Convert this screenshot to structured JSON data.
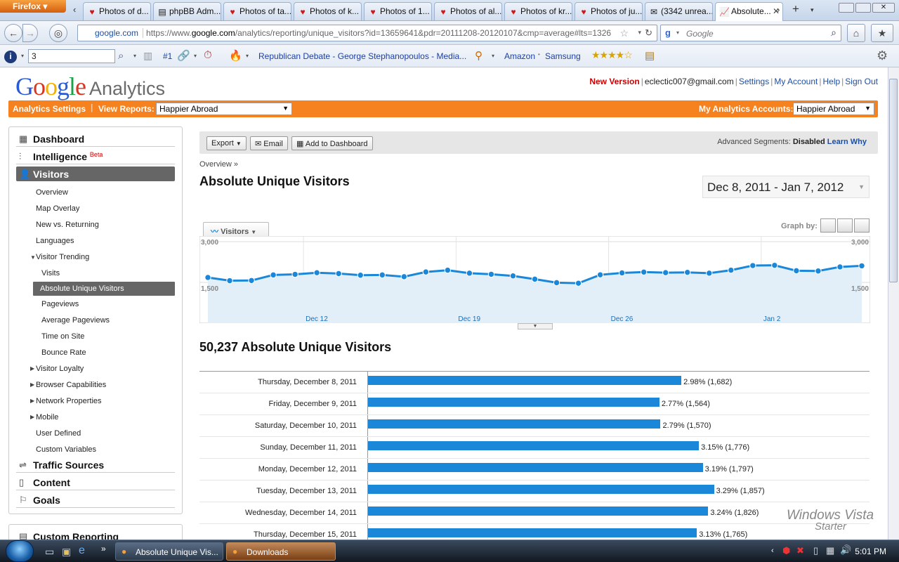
{
  "browser": {
    "firefox_label": "Firefox",
    "tabs": [
      {
        "title": "Photos of d...",
        "icon": "heart-icon"
      },
      {
        "title": "phpBB Adm...",
        "icon": "forum-icon"
      },
      {
        "title": "Photos of ta...",
        "icon": "heart-icon"
      },
      {
        "title": "Photos of k...",
        "icon": "heart-icon"
      },
      {
        "title": "Photos of 1...",
        "icon": "heart-icon"
      },
      {
        "title": "Photos of al...",
        "icon": "heart-icon"
      },
      {
        "title": "Photos of kr...",
        "icon": "heart-icon"
      },
      {
        "title": "Photos of ju...",
        "icon": "heart-icon"
      },
      {
        "title": "(3342 unrea...",
        "icon": "mail-icon"
      },
      {
        "title": "Absolute...",
        "icon": "analytics-icon",
        "active": true
      }
    ],
    "site_identity": "google.com",
    "url_prefix": "https://www.",
    "url_domain": "google.com",
    "url_path": "/analytics/reporting/unique_visitors?id=13659641&pdr=20111208-20120107&cmp=average#lts=1326",
    "search_placeholder": "Google",
    "bookmark_search_value": "3",
    "bookmark_counter": "#1",
    "bookmarks": [
      "Republican Debate - George Stephanopoulos - Media...",
      "Amazon",
      "Samsung"
    ]
  },
  "header": {
    "logo_google": "Google",
    "logo_analytics": "Analytics",
    "new_version": "New Version",
    "email": "eclectic007@gmail.com",
    "links": [
      "Settings",
      "My Account",
      "Help",
      "Sign Out"
    ],
    "analytics_settings": "Analytics Settings",
    "view_reports_label": "View Reports:",
    "view_reports_value": "Happier Abroad",
    "my_accounts_label": "My Analytics Accounts:",
    "my_accounts_value": "Happier Abroad"
  },
  "sidebar": {
    "dashboard": "Dashboard",
    "intelligence": "Intelligence",
    "beta": "Beta",
    "visitors": "Visitors",
    "sub_items": [
      "Overview",
      "Map Overlay",
      "New vs. Returning",
      "Languages"
    ],
    "visitor_trending": "Visitor Trending",
    "trending_items": [
      "Visits",
      "Absolute Unique Visitors",
      "Pageviews",
      "Average Pageviews",
      "Time on Site",
      "Bounce Rate"
    ],
    "collapsed_groups": [
      "Visitor Loyalty",
      "Browser Capabilities",
      "Network Properties",
      "Mobile"
    ],
    "plain_items": [
      "User Defined",
      "Custom Variables"
    ],
    "traffic_sources": "Traffic Sources",
    "content": "Content",
    "goals": "Goals",
    "custom_reporting": "Custom Reporting"
  },
  "toolbar": {
    "export": "Export",
    "email": "Email",
    "add_to_dashboard": "Add to Dashboard",
    "adv_segments_label": "Advanced Segments:",
    "adv_segments_value": "Disabled",
    "learn_why": "Learn Why"
  },
  "report": {
    "breadcrumb": "Overview »",
    "title": "Absolute Unique Visitors",
    "date_range": "Dec 8, 2011 - Jan 7, 2012",
    "graph_tab": "Visitors",
    "graph_by": "Graph by:",
    "total_line": "50,237 Absolute Unique Visitors"
  },
  "chart_data": [
    {
      "type": "line",
      "series": [
        {
          "name": "Visitors",
          "values": [
            1682,
            1564,
            1570,
            1776,
            1797,
            1857,
            1826,
            1765,
            1775,
            1710,
            1885,
            1950,
            1840,
            1800,
            1740,
            1620,
            1490,
            1470,
            1780,
            1850,
            1880,
            1860,
            1870,
            1840,
            1950,
            2120,
            2130,
            1930,
            1920,
            2070,
            2110
          ]
        }
      ],
      "x_ticks": [
        "Dec 12",
        "Dec 19",
        "Dec 26",
        "Jan 2"
      ],
      "x_tick_index": [
        4,
        11,
        18,
        25
      ],
      "y_ticks": [
        "3,000",
        "1,500"
      ],
      "ylim": [
        0,
        3000
      ],
      "color": "#1b87d8",
      "fill": "#e3eff8",
      "grid": true
    },
    {
      "type": "bar",
      "categories": [
        "Thursday, December 8, 2011",
        "Friday, December 9, 2011",
        "Saturday, December 10, 2011",
        "Sunday, December 11, 2011",
        "Monday, December 12, 2011",
        "Tuesday, December 13, 2011",
        "Wednesday, December 14, 2011",
        "Thursday, December 15, 2011"
      ],
      "values": [
        1682,
        1564,
        1570,
        1776,
        1797,
        1857,
        1826,
        1765
      ],
      "labels": [
        "2.98% (1,682)",
        "2.77% (1,564)",
        "2.79% (1,570)",
        "3.15% (1,776)",
        "3.19% (1,797)",
        "3.29% (1,857)",
        "3.24% (1,826)",
        "3.13% (1,765)"
      ],
      "color": "#1b87d8"
    }
  ],
  "os": {
    "watermark_line1": "Windows Vista",
    "watermark_line2": "Starter",
    "task_items": [
      "Absolute Unique Vis...",
      "Downloads"
    ],
    "clock": "5:01 PM"
  }
}
